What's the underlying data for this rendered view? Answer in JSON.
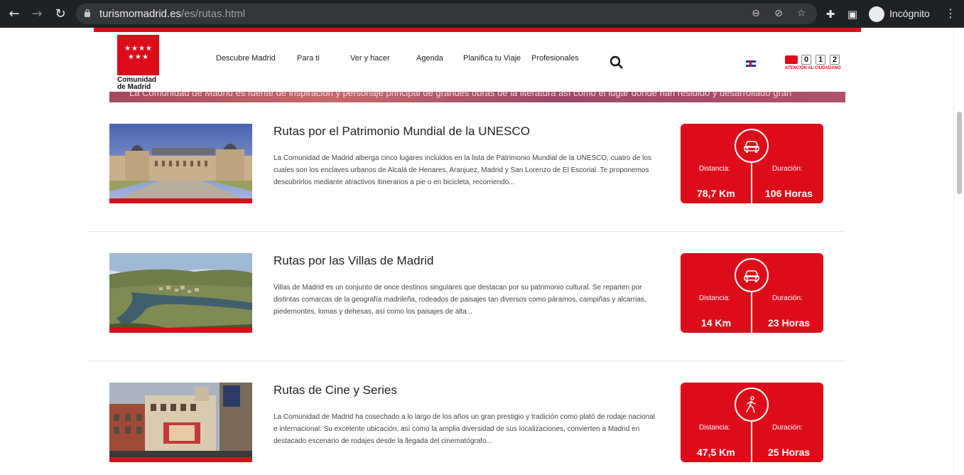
{
  "browser": {
    "url_host": "turismomadrid.es",
    "url_path": "/es/rutas.html",
    "profile_label": "Incógnito"
  },
  "header": {
    "logo_text_line1": "Comunidad",
    "logo_text_line2": "de Madrid",
    "menu": [
      "Descubre Madrid",
      "Para ti",
      "Ver y hacer",
      "Agenda",
      "Planifica tu Viaje",
      "Profesionales"
    ],
    "atencion_digits": [
      "0",
      "1",
      "2"
    ],
    "atencion_label": "ATENCIÓN AL CIUDADANO",
    "banner_text": "La Comunidad de Madrid es fuente de inspiración y personaje principal de grandes obras de la literatura así como el lugar donde han residido y desarrollado gran"
  },
  "routes": [
    {
      "title": "Rutas por el Patrimonio Mundial de la UNESCO",
      "description": "La Comunidad de Madrid alberga cinco lugares incluidos en la lista de Patrimonio Mundial de la UNESCO, cuatro de los cuales son los enclaves urbanos de Alcalá de Henares, Aranjuez, Madrid y San Lorenzo de El Escorial. Te proponemos descubrirlos mediante atractivos itinerarios a pie o en bicicleta, recorriendo...",
      "transport_icon": "car-icon",
      "distance_label": "Distancia:",
      "distance": "78,7 Km",
      "duration_label": "Duración:",
      "duration": "106 Horas"
    },
    {
      "title": "Rutas por las Villas de Madrid",
      "description": "Villas de Madrid es un conjunto de once destinos singulares que destacan por su patrimonio cultural. Se reparten por distintas comarcas de la geografía madrileña, rodeados de paisajes tan diversos como páramos, campiñas y alcarrias, piedemontes, lomas y dehesas, así como los paisajes de alta...",
      "transport_icon": "car-icon",
      "distance_label": "Distancia:",
      "distance": "14 Km",
      "duration_label": "Duración:",
      "duration": "23 Horas"
    },
    {
      "title": "Rutas de Cine y Series",
      "description": "La Comunidad de Madrid ha cosechado a lo largo de los años un gran prestigio y tradición como plató de rodaje nacional e internacional. Su excelente ubicación, así como la amplia diversidad de sus localizaciones, convierten a Madrid en destacado escenario de rodajes desde la llegada del cinematógrafo...",
      "transport_icon": "walking-icon",
      "distance_label": "Distancia:",
      "distance": "47,5 Km",
      "duration_label": "Duración:",
      "duration": "25 Horas"
    }
  ],
  "colors": {
    "brand_red": "#dd0c1a",
    "chrome_dark": "#202124"
  }
}
